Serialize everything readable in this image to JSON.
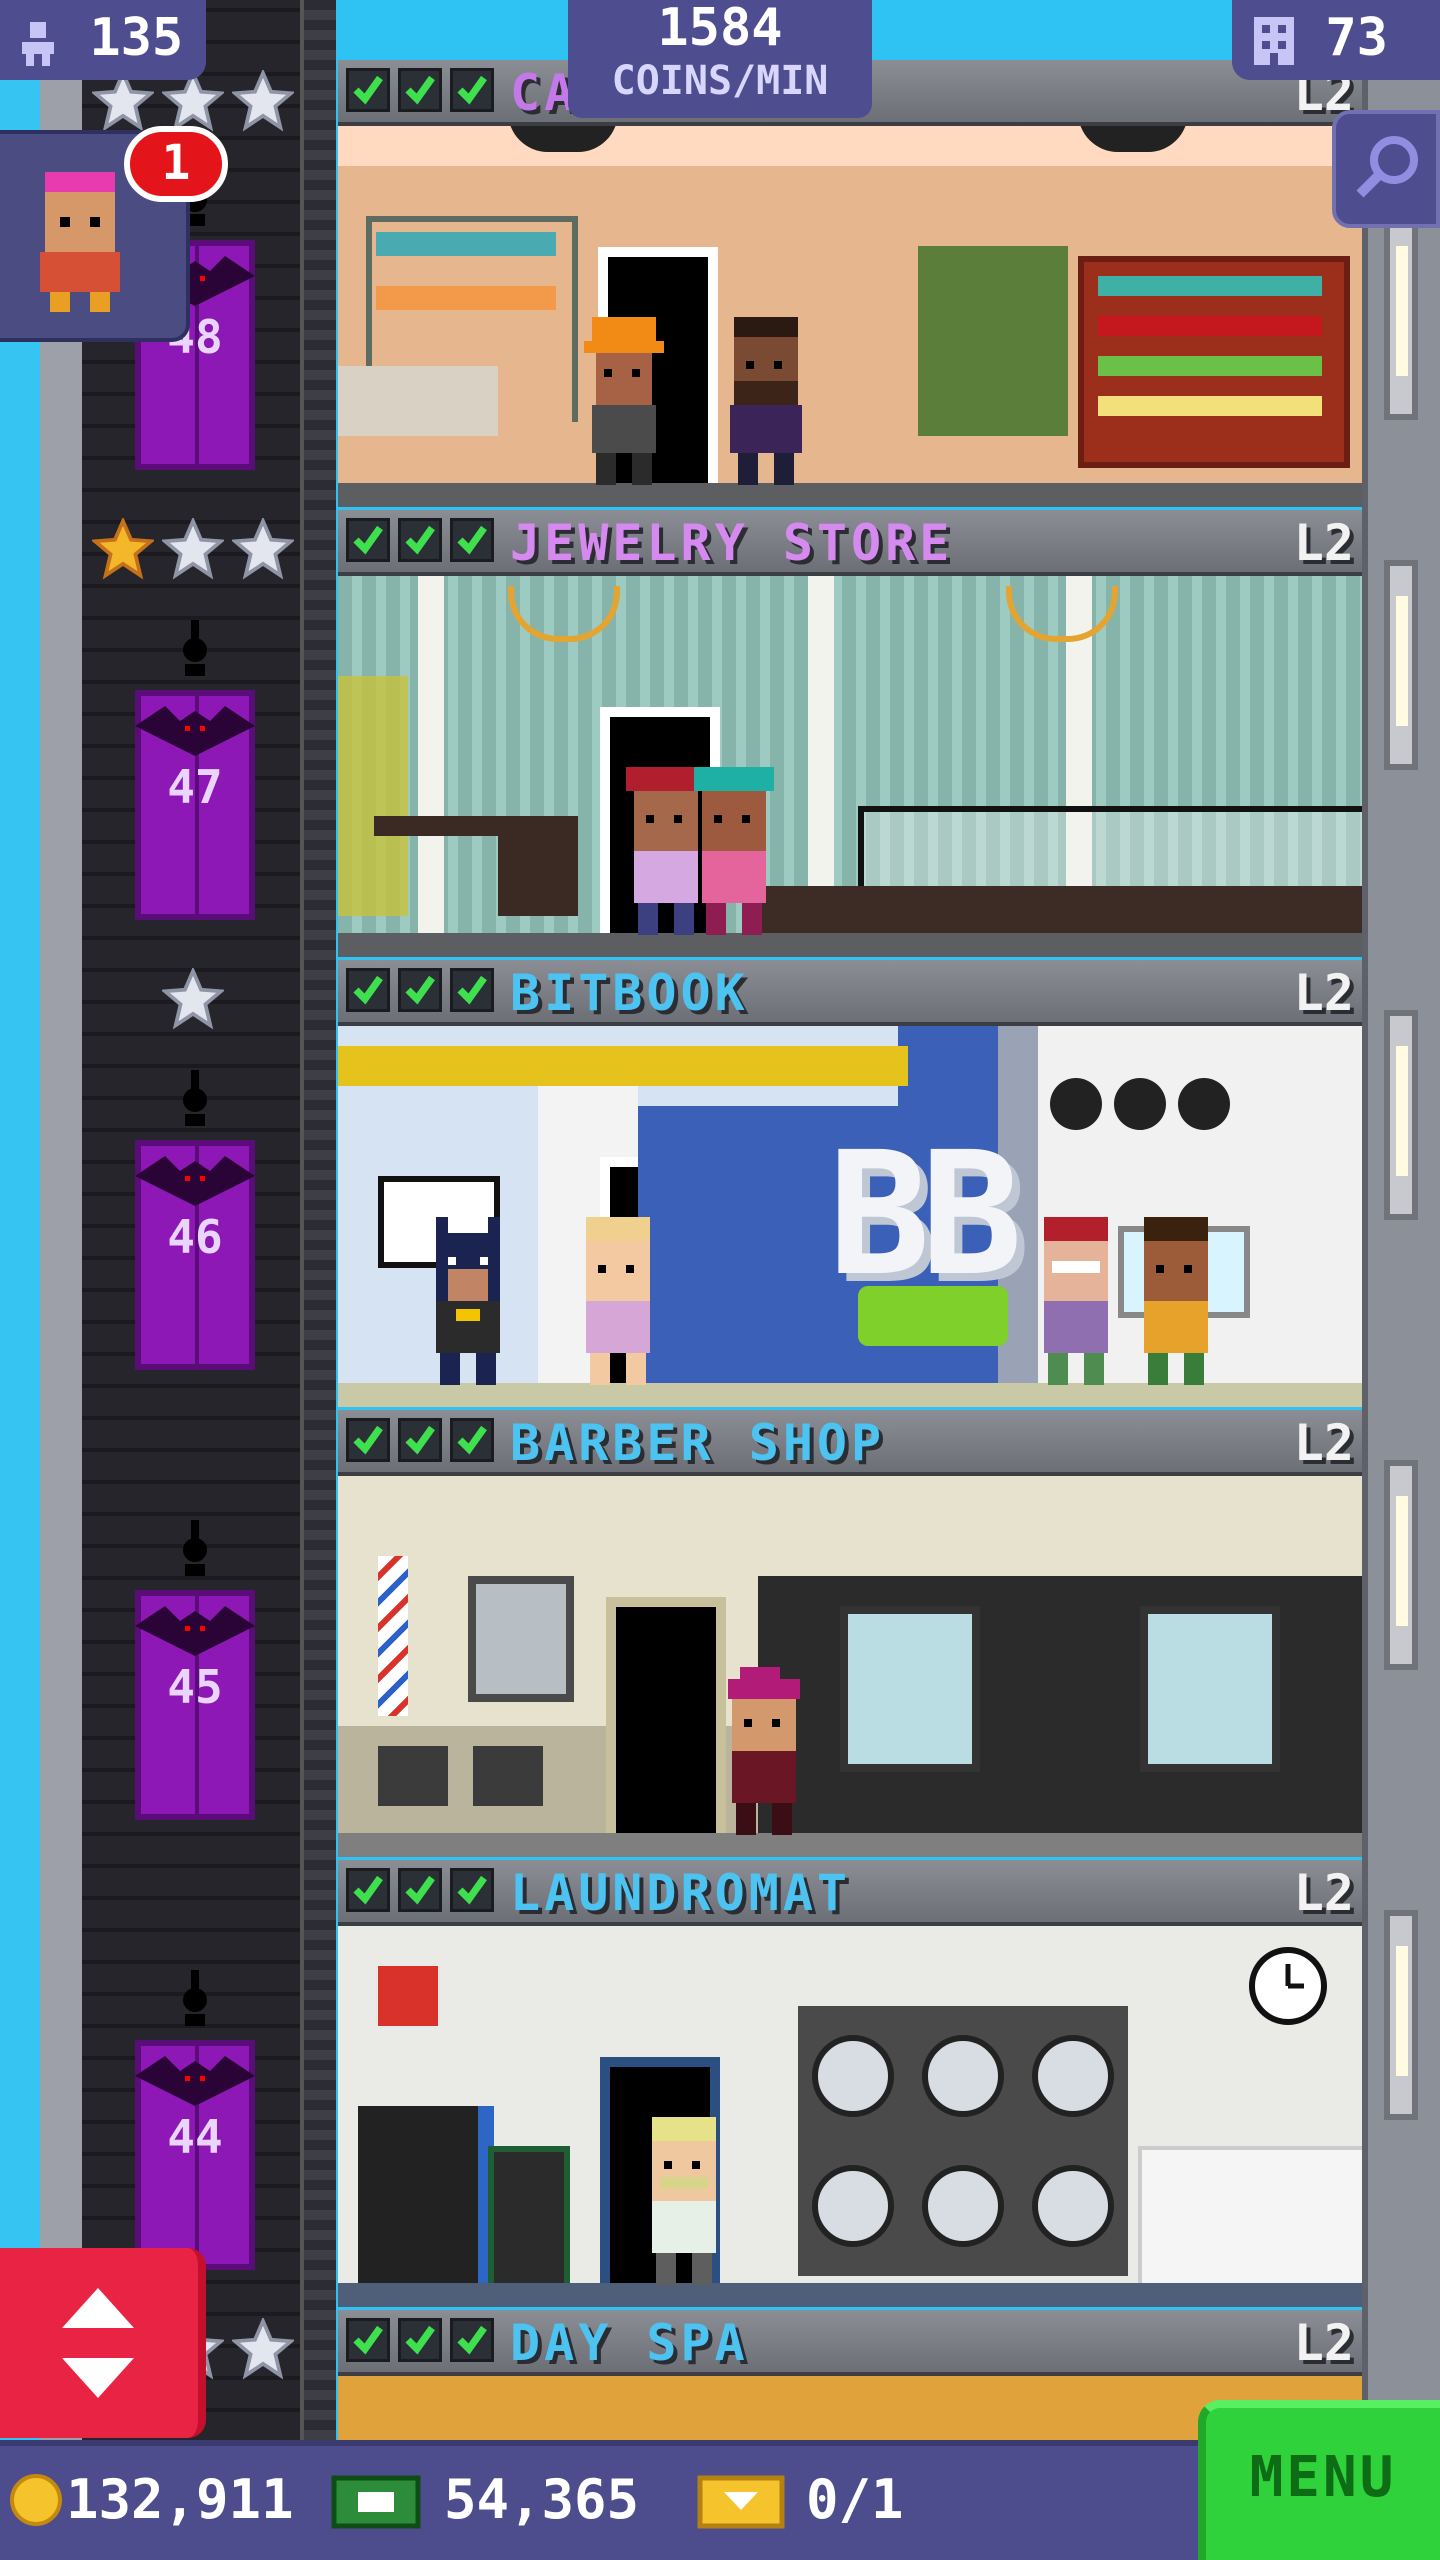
{
  "hud": {
    "population": "135",
    "coins_per_min_value": "1584",
    "coins_per_min_label": "COINS/MIN",
    "floor_count": "73",
    "visitor_badge": "1"
  },
  "elevator_floors": [
    "48",
    "47",
    "46",
    "45",
    "44"
  ],
  "floors": [
    {
      "name": "CAKE SHOP",
      "visible_name": "CA    OP",
      "level": "L2",
      "stars": 3
    },
    {
      "name": "JEWELRY STORE",
      "level": "L2",
      "stars": 3
    },
    {
      "name": "BITBOOK",
      "level": "L2",
      "stars": 1
    },
    {
      "name": "BARBER SHOP",
      "level": "L2",
      "stars": 0
    },
    {
      "name": "LAUNDROMAT",
      "level": "L2",
      "stars": 0
    },
    {
      "name": "DAY SPA",
      "level": "L2",
      "stars": 2
    }
  ],
  "room_colors": {
    "cake_shop": "#e0b08a",
    "jewelry_store": "#8fb9b0",
    "bitbook": "#3c63b8",
    "barber_shop": "#e7e3cf",
    "laundromat": "#e9eae4",
    "cake_name": "#c37ae8",
    "jewelry_name": "#d68af0",
    "blue_name": "#4cc3f0"
  },
  "bitbook_logo": "BB",
  "bottom": {
    "coins": "132,911",
    "bux": "54,365",
    "tickets": "0/1",
    "menu_label": "MENU"
  },
  "icons": [
    "person-icon",
    "building-icon",
    "magnifier-icon",
    "coin-icon",
    "bux-icon",
    "ticket-icon",
    "up-down-arrows-icon",
    "checkmark-icon",
    "star-icon",
    "bat-icon"
  ]
}
